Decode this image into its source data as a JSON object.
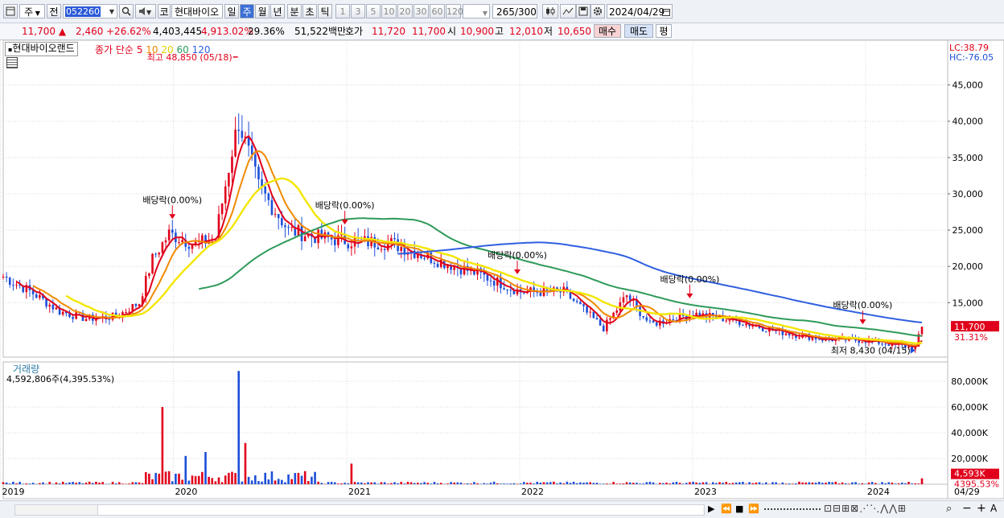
{
  "toolbar": {
    "market_label": "주",
    "prev_label": "전",
    "code": "052260",
    "ko_label": "코",
    "stock_name": "현대바이오",
    "period_buttons": [
      "일",
      "주",
      "월",
      "년",
      "분",
      "초",
      "틱"
    ],
    "active_period": "주",
    "interval_buttons": [
      "1",
      "3",
      "5",
      "10",
      "20",
      "30",
      "60",
      "120"
    ],
    "count_value": "265",
    "count_max": "/300",
    "date_value": "2024/04/29"
  },
  "quote": {
    "price": "11,700",
    "change": "2,460",
    "change_rate": "+26.62%",
    "volume": "4,403,445",
    "volume_rate": "4,913.02%",
    "turnover_rate": "29.36%",
    "amount": "51,522백만",
    "ask_label": "호가",
    "ask1": "11,720",
    "ask2": "11,700",
    "open_label": "시",
    "open": "10,900",
    "high_label": "고",
    "high": "12,010",
    "low_label": "저",
    "low": "10,650",
    "buy_label": "매수",
    "sell_label": "매도",
    "avg_label": "평"
  },
  "price_pane": {
    "stock_tag": "현대바이오랜드",
    "ma_title": "종가 단순",
    "lc": "LC:38.79",
    "hc": "HC:-76.05",
    "high_note": "최고 48,850 (05/18)",
    "low_note": "최저 8,430 (04/15)",
    "dividend_label": "배당락(0.00%)",
    "current_price_tag": "11,700",
    "current_rate_tag": "31.31%"
  },
  "volume_pane": {
    "title": "거래량",
    "value_text": "4,592,806주(4,395.53%)",
    "current_tag": "4,593K",
    "current_rate_tag": "4395.53%"
  },
  "x_axis_end_label": "04/29",
  "colors": {
    "up": "#e0001b",
    "down": "#1d4fd8",
    "ma5": "#e0001b",
    "ma10": "#f08a00",
    "ma20": "#f3e600",
    "ma60": "#2e9a5a",
    "ma120": "#2f5fe0",
    "grid": "#d8d8d8"
  },
  "chart_data": {
    "type": "candlestick",
    "title": "현대바이오랜드",
    "x_ticks": [
      "2019",
      "2020",
      "2021",
      "2022",
      "2023",
      "2024"
    ],
    "x_range": [
      "2019-01-07",
      "2024-04-29"
    ],
    "y_ticks": [
      15000,
      20000,
      25000,
      30000,
      35000,
      40000,
      45000
    ],
    "ylim": [
      7500,
      50500
    ],
    "moving_averages": [
      {
        "name": "5",
        "color": "#e0001b"
      },
      {
        "name": "10",
        "color": "#f08a00"
      },
      {
        "name": "20",
        "color": "#f3e600"
      },
      {
        "name": "60",
        "color": "#2e9a5a"
      },
      {
        "name": "120",
        "color": "#2f5fe0"
      }
    ],
    "weekly_close": [
      {
        "date": "2019-01-07",
        "close": 18600
      },
      {
        "date": "2019-03-04",
        "close": 16600
      },
      {
        "date": "2019-05-06",
        "close": 13800
      },
      {
        "date": "2019-07-01",
        "close": 12800
      },
      {
        "date": "2019-09-02",
        "close": 13100
      },
      {
        "date": "2019-10-21",
        "close": 15000
      },
      {
        "date": "2019-11-18",
        "close": 21000
      },
      {
        "date": "2019-12-23",
        "close": 24500
      },
      {
        "date": "2020-02-17",
        "close": 23000
      },
      {
        "date": "2020-03-30",
        "close": 24000
      },
      {
        "date": "2020-05-04",
        "close": 36000
      },
      {
        "date": "2020-05-18",
        "close": 40000
      },
      {
        "date": "2020-06-29",
        "close": 31000
      },
      {
        "date": "2020-08-31",
        "close": 25000
      },
      {
        "date": "2020-11-02",
        "close": 24000
      },
      {
        "date": "2021-01-04",
        "close": 23500
      },
      {
        "date": "2021-04-05",
        "close": 23200
      },
      {
        "date": "2021-07-05",
        "close": 21000
      },
      {
        "date": "2021-10-04",
        "close": 19000
      },
      {
        "date": "2022-01-03",
        "close": 16500
      },
      {
        "date": "2022-04-04",
        "close": 16500
      },
      {
        "date": "2022-06-27",
        "close": 11500
      },
      {
        "date": "2022-08-15",
        "close": 16000
      },
      {
        "date": "2022-10-03",
        "close": 12000
      },
      {
        "date": "2023-01-02",
        "close": 13500
      },
      {
        "date": "2023-04-03",
        "close": 12500
      },
      {
        "date": "2023-07-03",
        "close": 11000
      },
      {
        "date": "2023-10-02",
        "close": 10000
      },
      {
        "date": "2024-01-01",
        "close": 9800
      },
      {
        "date": "2024-04-15",
        "close": 8800
      },
      {
        "date": "2024-04-29",
        "close": 11700
      }
    ],
    "annotations": [
      {
        "text": "최고 48,850 (05/18)",
        "date": "2020-05-18",
        "value": 48850
      },
      {
        "text": "최저 8,430 (04/15)",
        "date": "2024-04-15",
        "value": 8430
      },
      {
        "text": "배당락(0.00%)",
        "date": "2019-12-30"
      },
      {
        "text": "배당락(0.00%)",
        "date": "2020-12-28"
      },
      {
        "text": "배당락(0.00%)",
        "date": "2021-12-27"
      },
      {
        "text": "배당락(0.00%)",
        "date": "2022-12-26"
      },
      {
        "text": "배당락(0.00%)",
        "date": "2023-12-26"
      }
    ],
    "volume": {
      "y_ticks_k": [
        20000,
        40000,
        60000,
        80000
      ],
      "ylim_k": [
        0,
        95000
      ],
      "spikes": [
        {
          "date": "2019-12-09",
          "value_k": 60000
        },
        {
          "date": "2020-01-27",
          "value_k": 22000
        },
        {
          "date": "2020-03-09",
          "value_k": 25000
        },
        {
          "date": "2020-05-18",
          "value_k": 88000
        },
        {
          "date": "2020-06-01",
          "value_k": 32000
        },
        {
          "date": "2021-01-11",
          "value_k": 16000
        },
        {
          "date": "2024-04-29",
          "value_k": 4593
        }
      ]
    }
  }
}
